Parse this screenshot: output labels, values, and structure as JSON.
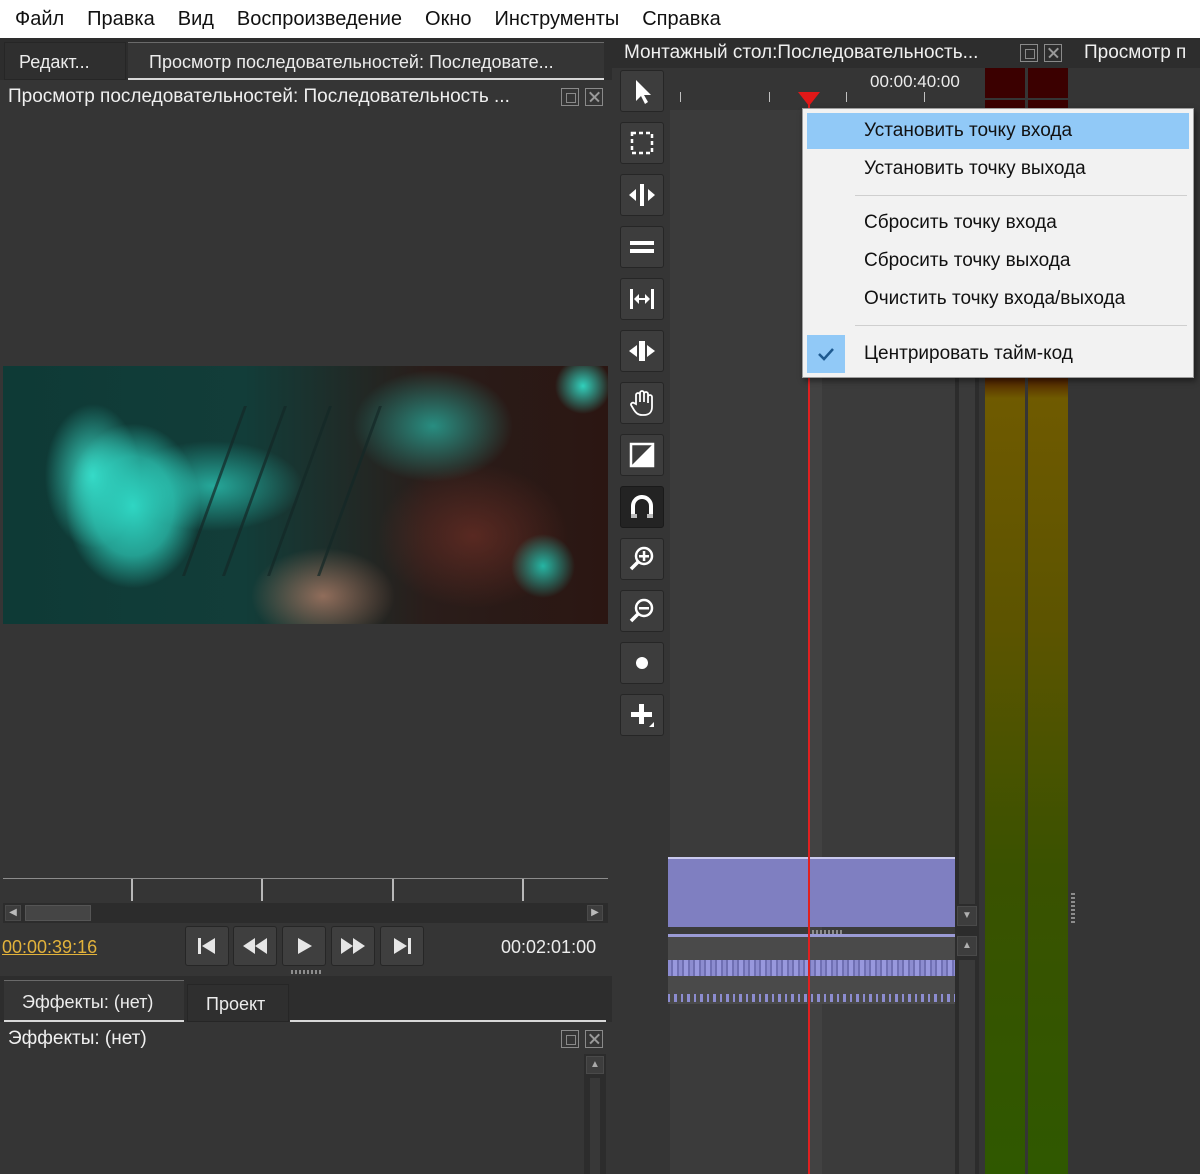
{
  "menubar": {
    "items": [
      "Файл",
      "Правка",
      "Вид",
      "Воспроизведение",
      "Окно",
      "Инструменты",
      "Справка"
    ]
  },
  "left_panel": {
    "tabs": [
      "Редакт...",
      "Просмотр последовательностей: Последовате..."
    ],
    "viewer_title": "Просмотр последовательностей: Последовательность ...",
    "current_timecode": "00:00:39:16",
    "total_timecode": "00:02:01:00"
  },
  "bottom_panel": {
    "tabs": [
      "Эффекты: (нет)",
      "Проект"
    ],
    "title": "Эффекты: (нет)"
  },
  "timeline": {
    "header_title": "Монтажный стол:Последовательность...",
    "next_panel_title": "Просмотр п",
    "ruler_timecode": "00:00:40:00"
  },
  "toolbar": {
    "tools": [
      "pointer",
      "marquee",
      "ripple",
      "rolling",
      "slip",
      "slide",
      "hand",
      "transition",
      "snapping",
      "zoom-in",
      "zoom-out",
      "record",
      "add"
    ]
  },
  "context_menu": {
    "items": [
      "Установить точку входа",
      "Установить точку выхода",
      "Сбросить точку входа",
      "Сбросить точку выхода",
      "Очистить точку входа/выхода",
      "Центрировать тайм-код"
    ],
    "highlighted_index": 0,
    "checked_index": 5
  },
  "colors": {
    "highlight": "#91c9f7",
    "playhead": "#e02020",
    "clip": "#7f7fc1",
    "timecode": "#e2b23b"
  }
}
